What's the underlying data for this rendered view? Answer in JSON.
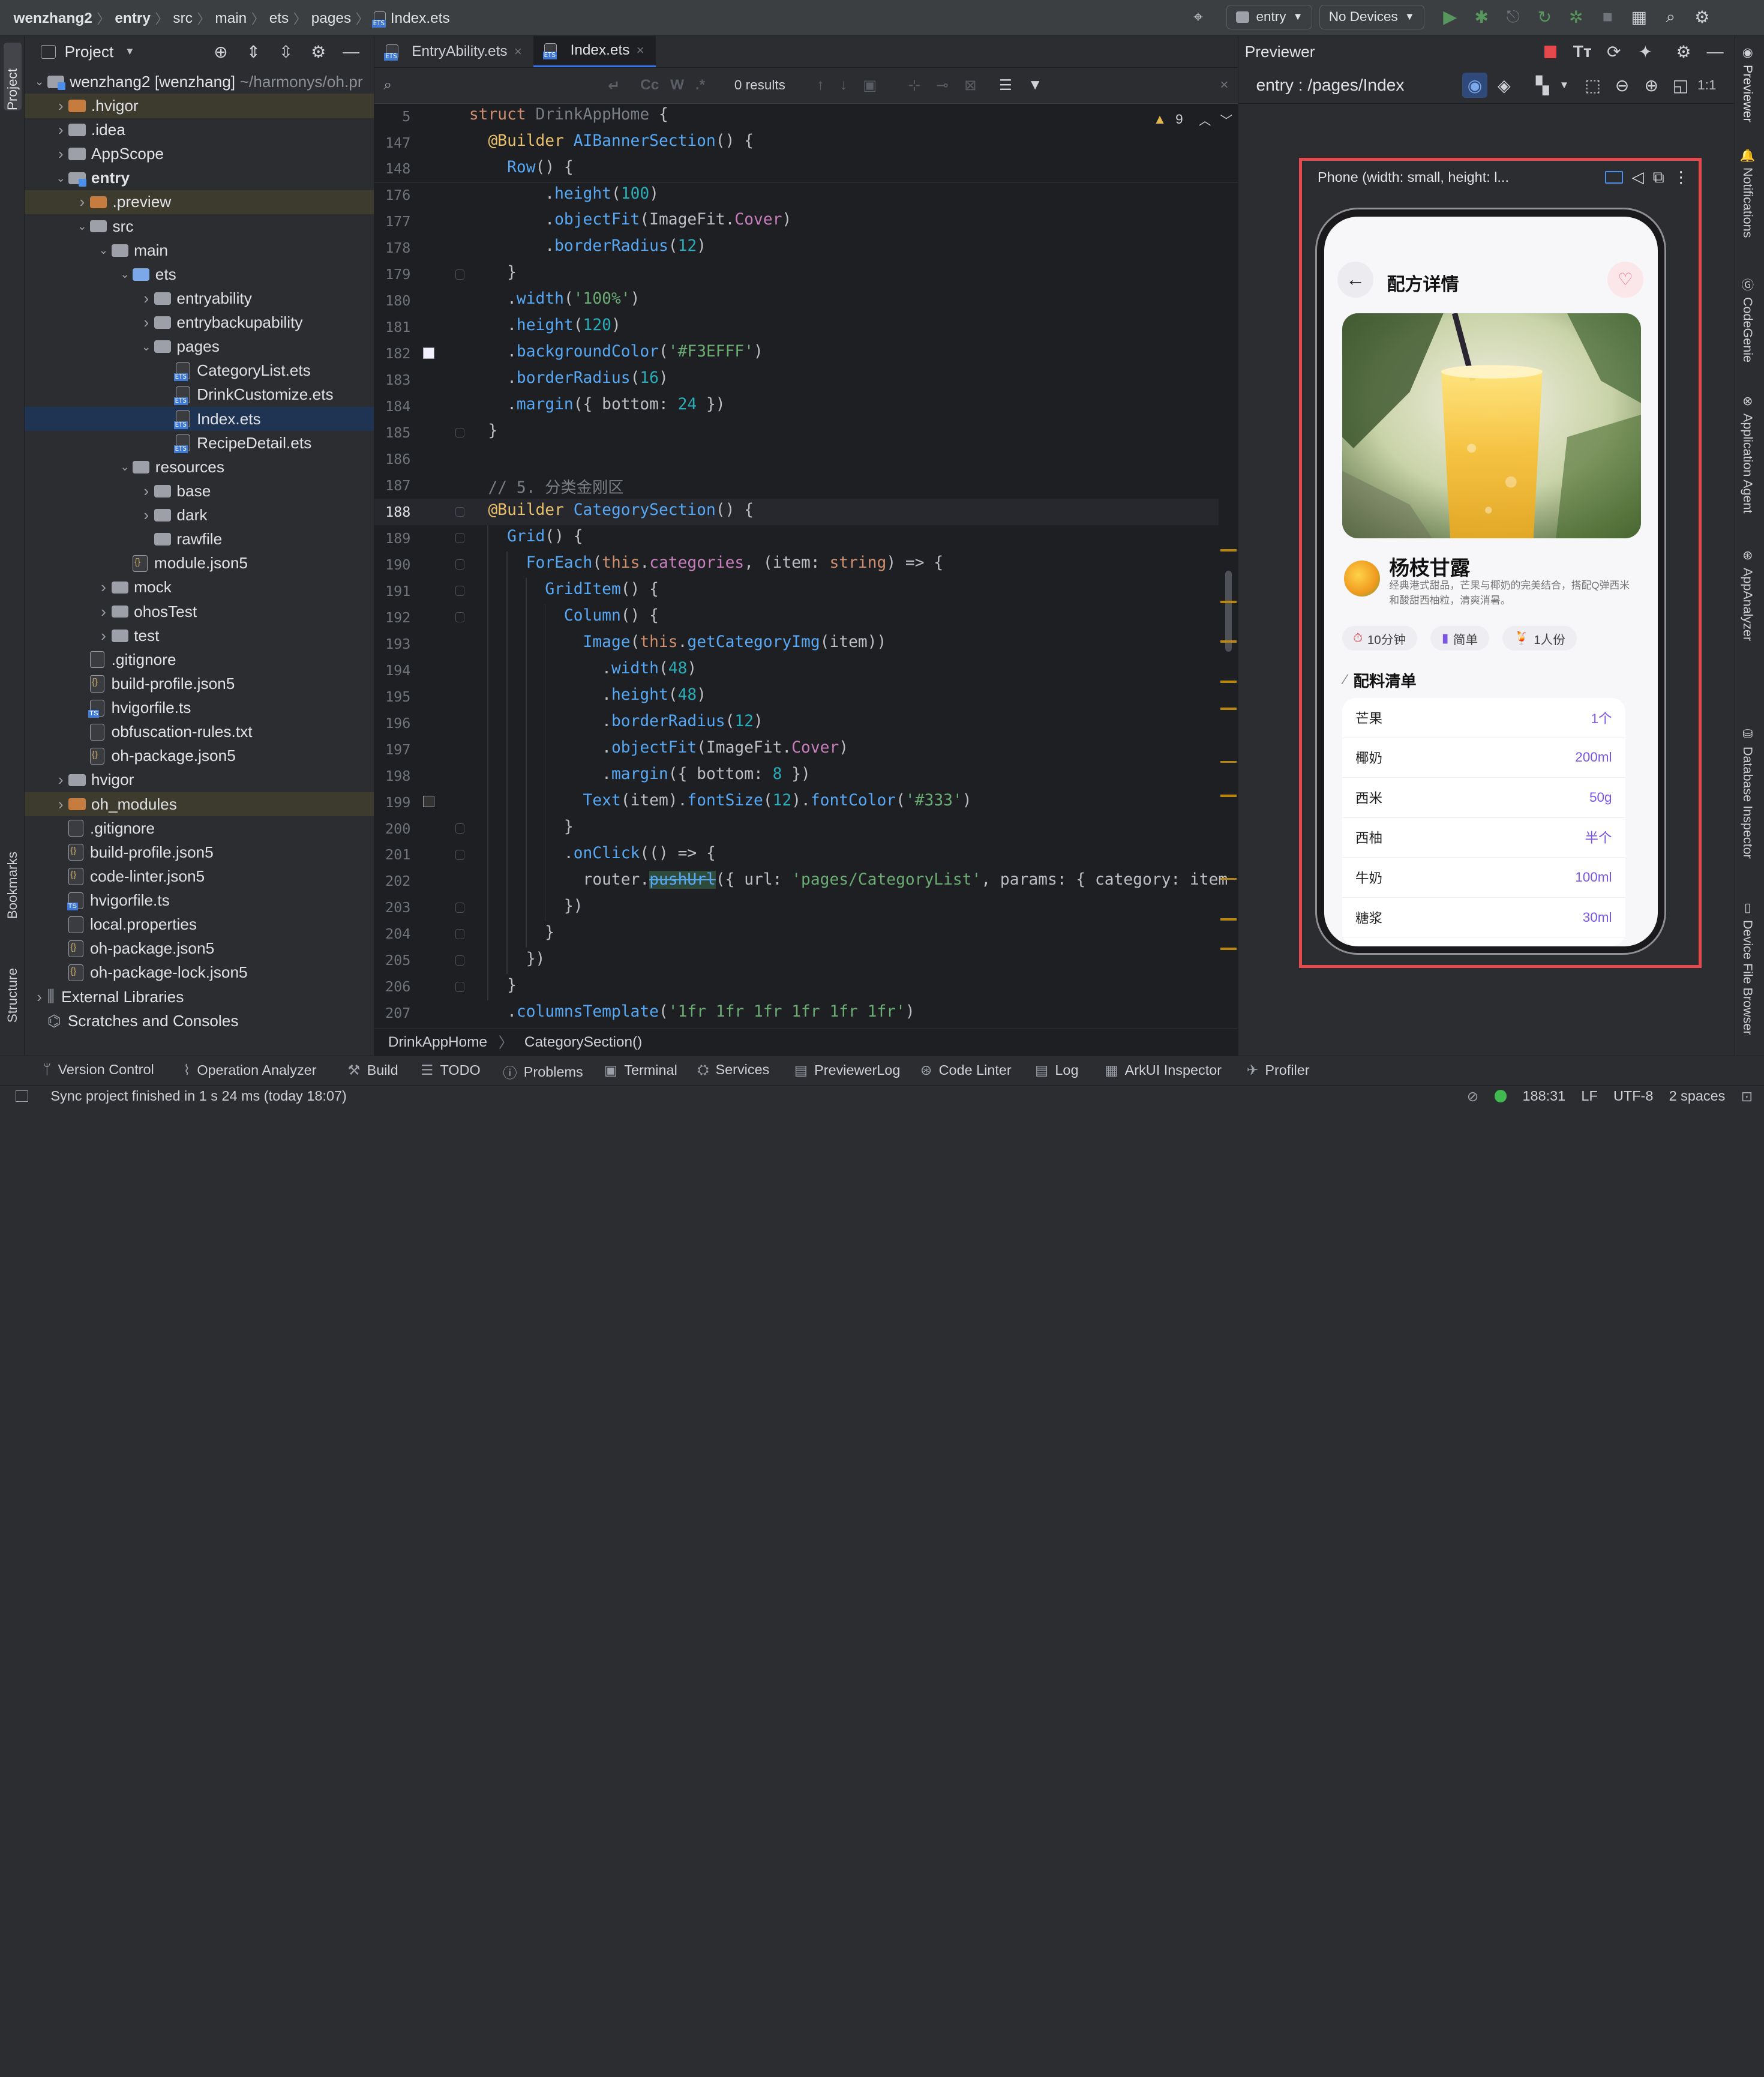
{
  "titlebar": {
    "breadcrumbs": [
      "wenzhang2",
      "entry",
      "src",
      "main",
      "ets",
      "pages",
      "Index.ets"
    ],
    "run_config": "entry",
    "device": "No Devices"
  },
  "leftstrip": {
    "project": "Project",
    "bookmarks": "Bookmarks",
    "structure": "Structure"
  },
  "project": {
    "title": "Project",
    "tree": [
      {
        "label": "wenzhang2 [wenzhang]",
        "hint": "~/harmonys/oh.pr",
        "depth": 0,
        "kind": "mod",
        "open": true
      },
      {
        "label": ".hvigor",
        "depth": 1,
        "kind": "orange",
        "open": false,
        "excl": true
      },
      {
        "label": ".idea",
        "depth": 1,
        "kind": "folder",
        "open": false
      },
      {
        "label": "AppScope",
        "depth": 1,
        "kind": "folder",
        "open": false
      },
      {
        "label": "entry",
        "depth": 1,
        "kind": "mod",
        "open": true,
        "bold": true
      },
      {
        "label": ".preview",
        "depth": 2,
        "kind": "orange",
        "open": false,
        "excl": true
      },
      {
        "label": "src",
        "depth": 2,
        "kind": "folder",
        "open": true
      },
      {
        "label": "main",
        "depth": 3,
        "kind": "folder",
        "open": true
      },
      {
        "label": "ets",
        "depth": 4,
        "kind": "blue",
        "open": true
      },
      {
        "label": "entryability",
        "depth": 5,
        "kind": "folder",
        "open": false
      },
      {
        "label": "entrybackupability",
        "depth": 5,
        "kind": "folder",
        "open": false
      },
      {
        "label": "pages",
        "depth": 5,
        "kind": "folder",
        "open": true
      },
      {
        "label": "CategoryList.ets",
        "depth": 6,
        "kind": "ets"
      },
      {
        "label": "DrinkCustomize.ets",
        "depth": 6,
        "kind": "ets"
      },
      {
        "label": "Index.ets",
        "depth": 6,
        "kind": "ets",
        "sel": true
      },
      {
        "label": "RecipeDetail.ets",
        "depth": 6,
        "kind": "ets"
      },
      {
        "label": "resources",
        "depth": 4,
        "kind": "folder",
        "open": true
      },
      {
        "label": "base",
        "depth": 5,
        "kind": "folder",
        "open": false
      },
      {
        "label": "dark",
        "depth": 5,
        "kind": "folder",
        "open": false
      },
      {
        "label": "rawfile",
        "depth": 5,
        "kind": "folder"
      },
      {
        "label": "module.json5",
        "depth": 4,
        "kind": "json"
      },
      {
        "label": "mock",
        "depth": 3,
        "kind": "folder",
        "open": false
      },
      {
        "label": "ohosTest",
        "depth": 3,
        "kind": "folder",
        "open": false
      },
      {
        "label": "test",
        "depth": 3,
        "kind": "folder",
        "open": false
      },
      {
        "label": ".gitignore",
        "depth": 2,
        "kind": "file"
      },
      {
        "label": "build-profile.json5",
        "depth": 2,
        "kind": "json"
      },
      {
        "label": "hvigorfile.ts",
        "depth": 2,
        "kind": "ts"
      },
      {
        "label": "obfuscation-rules.txt",
        "depth": 2,
        "kind": "file"
      },
      {
        "label": "oh-package.json5",
        "depth": 2,
        "kind": "json"
      },
      {
        "label": "hvigor",
        "depth": 1,
        "kind": "folder",
        "open": false
      },
      {
        "label": "oh_modules",
        "depth": 1,
        "kind": "orange",
        "open": false,
        "excl": true
      },
      {
        "label": ".gitignore",
        "depth": 1,
        "kind": "file"
      },
      {
        "label": "build-profile.json5",
        "depth": 1,
        "kind": "json"
      },
      {
        "label": "code-linter.json5",
        "depth": 1,
        "kind": "json"
      },
      {
        "label": "hvigorfile.ts",
        "depth": 1,
        "kind": "ts"
      },
      {
        "label": "local.properties",
        "depth": 1,
        "kind": "file"
      },
      {
        "label": "oh-package.json5",
        "depth": 1,
        "kind": "json"
      },
      {
        "label": "oh-package-lock.json5",
        "depth": 1,
        "kind": "json"
      },
      {
        "label": "External Libraries",
        "depth": 0,
        "kind": "lib",
        "open": false
      },
      {
        "label": "Scratches and Consoles",
        "depth": 0,
        "kind": "scratch"
      }
    ]
  },
  "editor": {
    "tabs": [
      {
        "label": "EntryAbility.ets"
      },
      {
        "label": "Index.ets",
        "active": true
      }
    ],
    "find": {
      "placeholder": "",
      "results": "0 results"
    },
    "warnings": "9",
    "sticky": [
      {
        "ln": "5",
        "html": "<span class='kw'>struct</span> <span class='cm'>DrinkAppHome</span> {"
      },
      {
        "ln": "147",
        "html": "  <span class='ex'>@Builder</span> <span class='fn'>AIBannerSection</span>() {"
      },
      {
        "ln": "148",
        "html": "    <span class='fn'>Row</span>() {"
      }
    ],
    "lines": [
      {
        "ln": "176",
        "html": "        .<span class='fn'>height</span>(<span class='nm'>100</span>)"
      },
      {
        "ln": "177",
        "html": "        .<span class='fn'>objectFit</span>(ImageFit.<span class='pr'>Cover</span>)"
      },
      {
        "ln": "178",
        "html": "        .<span class='fn'>borderRadius</span>(<span class='nm'>12</span>)"
      },
      {
        "ln": "179",
        "html": "    }"
      },
      {
        "ln": "180",
        "html": "    .<span class='fn'>width</span>(<span class='st'>'100%'</span>)"
      },
      {
        "ln": "181",
        "html": "    .<span class='fn'>height</span>(<span class='nm'>120</span>)"
      },
      {
        "ln": "182",
        "html": "    .<span class='fn'>backgroundColor</span>(<span class='st'>'#F3EFFF'</span>)"
      },
      {
        "ln": "183",
        "html": "    .<span class='fn'>borderRadius</span>(<span class='nm'>16</span>)"
      },
      {
        "ln": "184",
        "html": "    .<span class='fn'>margin</span>({ bottom: <span class='nm'>24</span> })"
      },
      {
        "ln": "185",
        "html": "  }"
      },
      {
        "ln": "186",
        "html": ""
      },
      {
        "ln": "187",
        "html": "  <span class='cm'>// 5. 分类金刚区</span>"
      },
      {
        "ln": "188",
        "html": "  <span class='ex'>@Builder</span> <span class='fn'>CategorySection</span>() {",
        "cur": true
      },
      {
        "ln": "189",
        "html": "    <span class='fn'>Grid</span>() {"
      },
      {
        "ln": "190",
        "html": "      <span class='fn'>ForEach</span>(<span class='kw'>this</span>.<span class='pr'>categories</span>, (item: <span class='kw'>string</span>) => {"
      },
      {
        "ln": "191",
        "html": "        <span class='fn'>GridItem</span>() {"
      },
      {
        "ln": "192",
        "html": "          <span class='fn'>Column</span>() {"
      },
      {
        "ln": "193",
        "html": "            <span class='fn'>Image</span>(<span class='kw'>this</span>.<span class='fn'>getCategoryImg</span>(item))"
      },
      {
        "ln": "194",
        "html": "              .<span class='fn'>width</span>(<span class='nm'>48</span>)"
      },
      {
        "ln": "195",
        "html": "              .<span class='fn'>height</span>(<span class='nm'>48</span>)"
      },
      {
        "ln": "196",
        "html": "              .<span class='fn'>borderRadius</span>(<span class='nm'>12</span>)"
      },
      {
        "ln": "197",
        "html": "              .<span class='fn'>objectFit</span>(ImageFit.<span class='pr'>Cover</span>)"
      },
      {
        "ln": "198",
        "html": "              .<span class='fn'>margin</span>({ bottom: <span class='nm'>8</span> })"
      },
      {
        "ln": "199",
        "html": "            <span class='fn'>Text</span>(item).<span class='fn'>fontSize</span>(<span class='nm'>12</span>).<span class='fn'>fontColor</span>(<span class='st'>'#333'</span>)"
      },
      {
        "ln": "200",
        "html": "          }"
      },
      {
        "ln": "201",
        "html": "          .<span class='fn'>onClick</span>(() => {"
      },
      {
        "ln": "202",
        "html": "            router.<span class='fn' style='text-decoration:line-through;background:#2e4a3a'>pushUrl</span>({ url: <span class='st'>'pages/CategoryList'</span>, params: { category: item }"
      },
      {
        "ln": "203",
        "html": "          })"
      },
      {
        "ln": "204",
        "html": "        }"
      },
      {
        "ln": "205",
        "html": "      })"
      },
      {
        "ln": "206",
        "html": "    }"
      },
      {
        "ln": "207",
        "html": "    .<span class='fn'>columnsTemplate</span>(<span class='st'>'1fr 1fr 1fr 1fr 1fr 1fr'</span>)"
      }
    ],
    "breadcrumb": [
      "DrinkAppHome",
      "CategorySection()"
    ]
  },
  "previewer": {
    "title": "Previewer",
    "route": "entry : /pages/Index",
    "device_label": "Phone (width: small, height: l...",
    "app": {
      "page_title": "配方详情",
      "drink_name": "杨枝甘露",
      "description": "经典港式甜品，芒果与椰奶的完美结合，搭配Q弹西米和酸甜西柚粒，清爽消暑。",
      "chips": [
        "10分钟",
        "简单",
        "1人份"
      ],
      "section_title": "配料清单",
      "ingredients": [
        {
          "name": "芒果",
          "qty": "1个"
        },
        {
          "name": "椰奶",
          "qty": "200ml"
        },
        {
          "name": "西米",
          "qty": "50g"
        },
        {
          "name": "西柚",
          "qty": "半个"
        },
        {
          "name": "牛奶",
          "qty": "100ml"
        },
        {
          "name": "糖浆",
          "qty": "30ml"
        }
      ],
      "accent": "#7b55e6"
    }
  },
  "rightstrip": [
    "Previewer",
    "Notifications",
    "CodeGenie",
    "Application Agent",
    "AppAnalyzer",
    "Database Inspector",
    "Device File Browser"
  ],
  "toolwindows": [
    "Version Control",
    "Operation Analyzer",
    "Build",
    "TODO",
    "Problems",
    "Terminal",
    "Services",
    "PreviewerLog",
    "Code Linter",
    "Log",
    "ArkUI Inspector",
    "Profiler"
  ],
  "status": {
    "message": "Sync project finished in 1 s 24 ms (today 18:07)",
    "position": "188:31",
    "line_sep": "LF",
    "encoding": "UTF-8",
    "indent": "2 spaces"
  }
}
